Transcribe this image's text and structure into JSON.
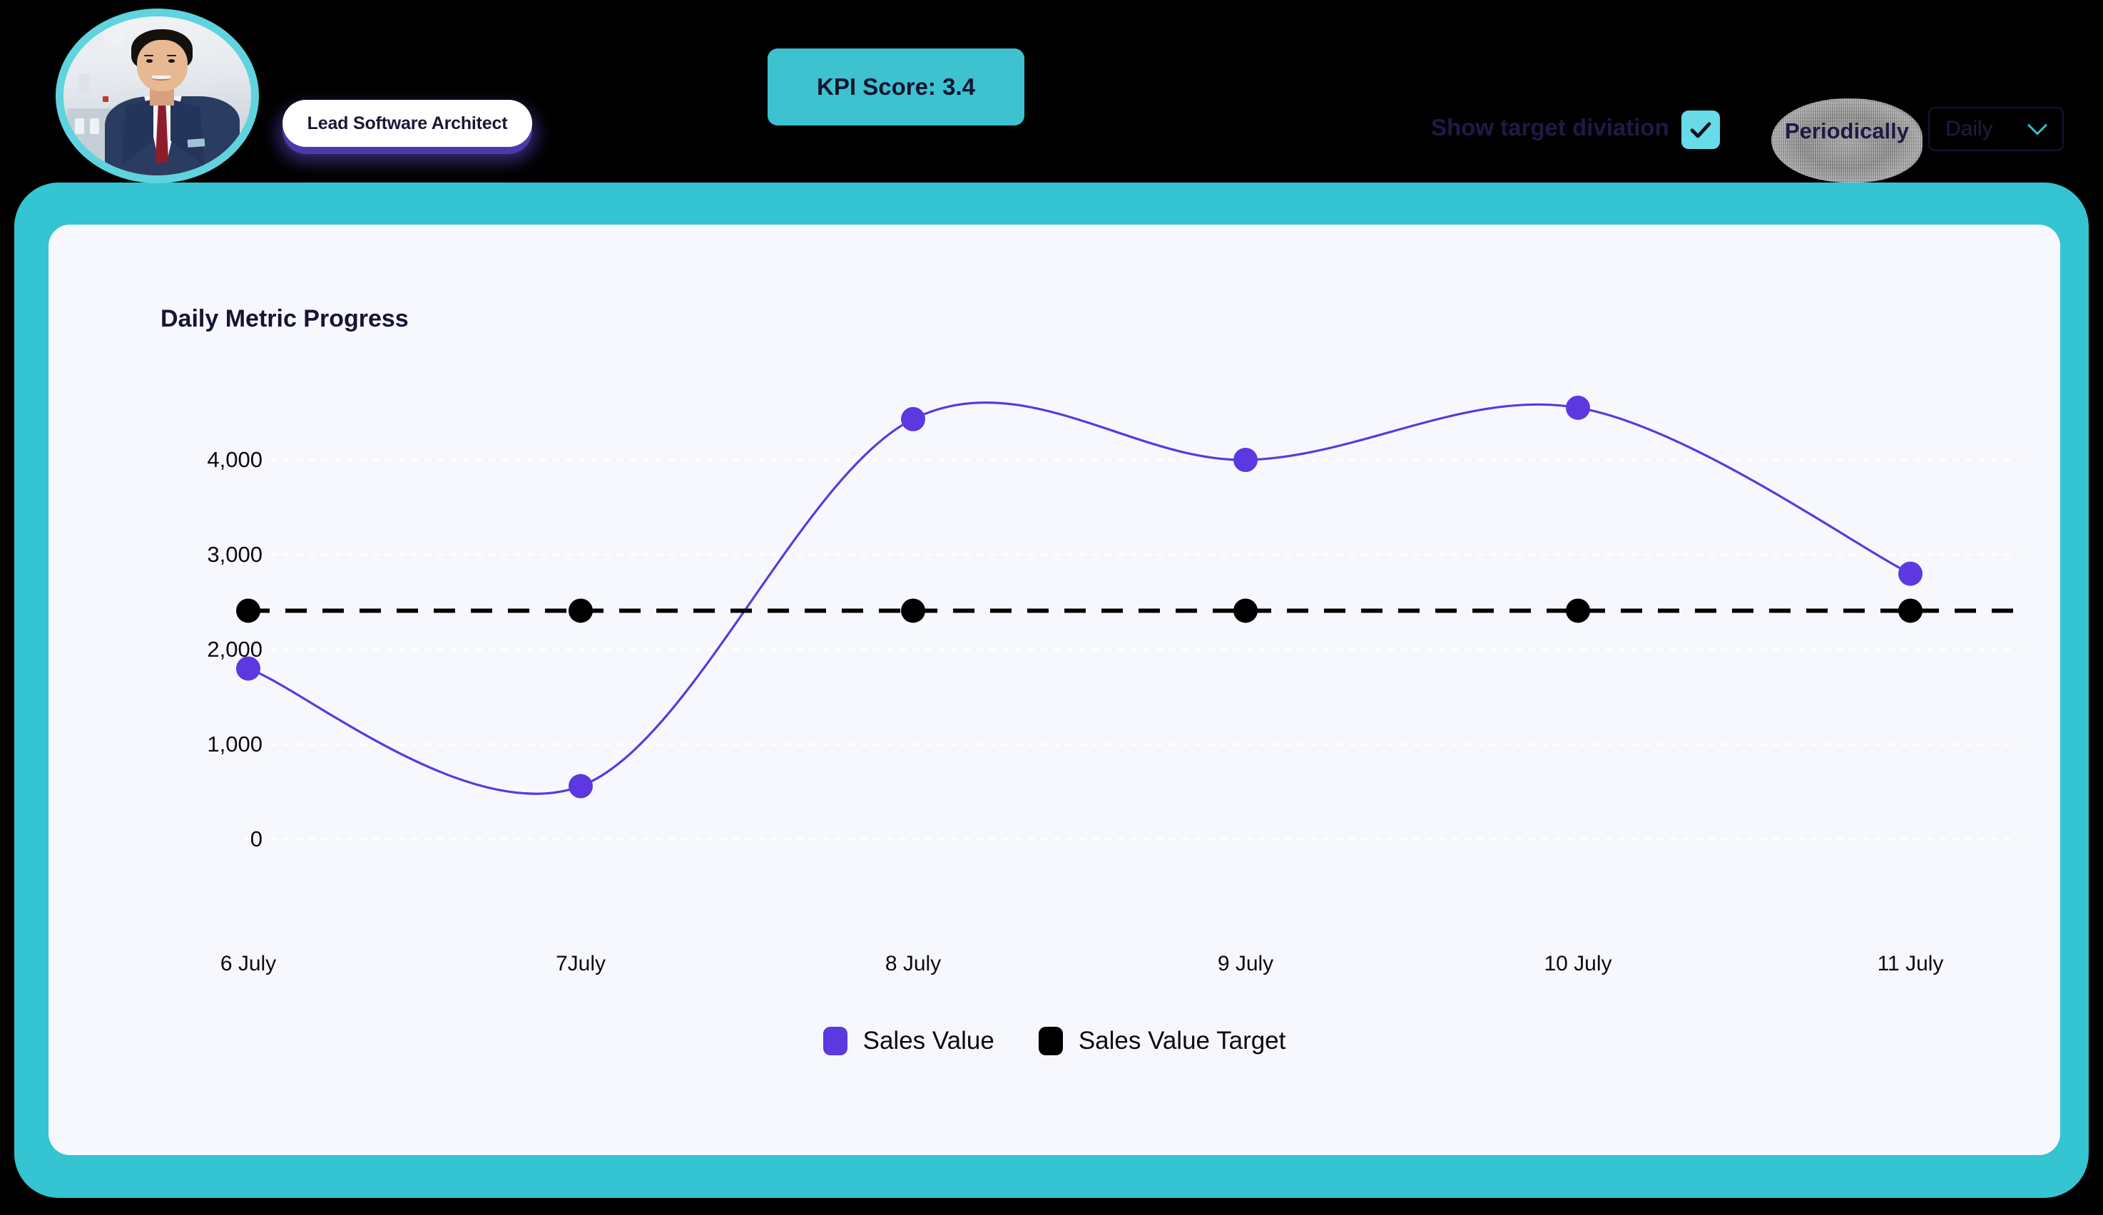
{
  "header": {
    "avatar_alt": "profile-photo",
    "role_label": "Lead Software Architect",
    "kpi_label": "KPI Score: 3.4",
    "deviation_label": "Show target diviation",
    "deviation_checked": true,
    "periodically_label": "Periodically",
    "period_value": "Daily",
    "period_options": [
      "Daily"
    ],
    "chevron_icon": "chevron-down-icon",
    "check_icon": "check-icon"
  },
  "colors": {
    "teal_panel": "#35c4d1",
    "card_bg": "#f7f8fd",
    "accent_cyan": "#3ec2d0",
    "checkbox_cyan": "#67dbe8",
    "series_purple": "#5b38e0",
    "target_black": "#000000",
    "text_dark": "#171433",
    "avatar_ring": "#5fd3de",
    "pill_shadow": "#4b3aa8"
  },
  "chart_data": {
    "type": "line",
    "title": "Daily Metric Progress",
    "xlabel": "",
    "ylabel": "",
    "categories": [
      "6 July",
      "7July",
      "8 July",
      "9 July",
      "10 July",
      "11 July"
    ],
    "ylim": [
      0,
      4800
    ],
    "yticks": [
      0,
      1000,
      2000,
      3000,
      4000
    ],
    "ytick_labels": [
      "0",
      "1,000",
      "2,000",
      "3,000",
      "4,000"
    ],
    "grid": true,
    "legend_position": "bottom",
    "curve": "smooth",
    "series": [
      {
        "name": "Sales Value",
        "color": "#5b38e0",
        "style": "solid",
        "marker": "circle",
        "values": [
          1800,
          560,
          4430,
          4000,
          4550,
          2800
        ]
      },
      {
        "name": "Sales Value Target",
        "color": "#000000",
        "style": "dashed",
        "marker": "circle",
        "values": [
          2410,
          2410,
          2410,
          2410,
          2410,
          2410
        ]
      }
    ]
  }
}
